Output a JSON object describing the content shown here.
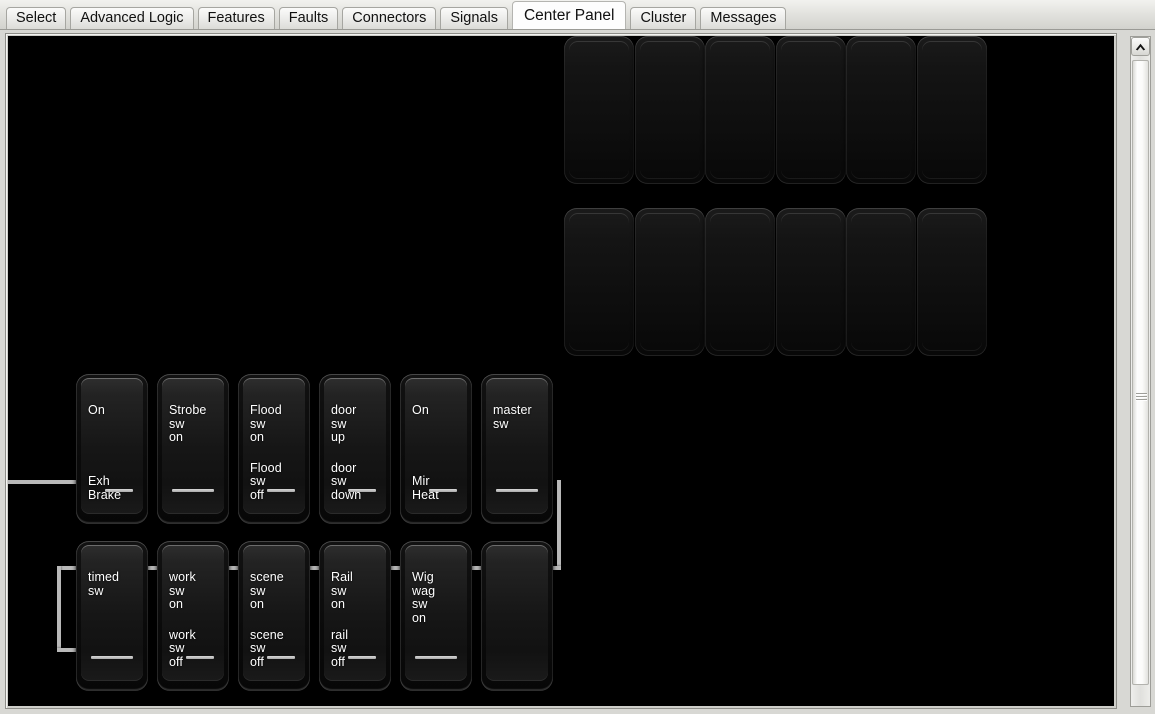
{
  "window": {
    "title": "Center Panel"
  },
  "tabs": [
    {
      "label": "Select",
      "active": false
    },
    {
      "label": "Advanced Logic",
      "active": false
    },
    {
      "label": "Features",
      "active": false
    },
    {
      "label": "Faults",
      "active": false
    },
    {
      "label": "Connectors",
      "active": false
    },
    {
      "label": "Signals",
      "active": false
    },
    {
      "label": "Center Panel",
      "active": true
    },
    {
      "label": "Cluster",
      "active": false
    },
    {
      "label": "Messages",
      "active": false
    }
  ],
  "panel": {
    "background_color": "#000000",
    "frame_color": "#cfcfca",
    "wire_color": "#b9b9b9"
  },
  "empty_slots": {
    "count": 12,
    "rows": 2,
    "columns": 6
  },
  "switch_rows": [
    {
      "row": 1,
      "switches": [
        {
          "top_label": "On",
          "bottom_label": "Exh\nBrake",
          "bar": "short"
        },
        {
          "top_label": "Strobe\nsw\non",
          "bottom_label": "",
          "bar": "full"
        },
        {
          "top_label": "Flood\nsw\non",
          "bottom_label": "Flood\nsw\noff",
          "bar": "short"
        },
        {
          "top_label": "door\nsw\nup",
          "bottom_label": "door\nsw\ndown",
          "bar": "short"
        },
        {
          "top_label": "On",
          "bottom_label": "Mir\nHeat",
          "bar": "short"
        },
        {
          "top_label": "master\nsw",
          "bottom_label": "",
          "bar": "full"
        }
      ]
    },
    {
      "row": 2,
      "switches": [
        {
          "top_label": "timed\nsw",
          "bottom_label": "",
          "bar": "full"
        },
        {
          "top_label": "work\nsw\non",
          "bottom_label": "work\nsw\noff",
          "bar": "short"
        },
        {
          "top_label": "scene\nsw\non",
          "bottom_label": "scene\nsw\noff",
          "bar": "short"
        },
        {
          "top_label": "Rail\nsw\non",
          "bottom_label": "rail\nsw\noff",
          "bar": "short"
        },
        {
          "top_label": "Wig\nwag\nsw\non",
          "bottom_label": "",
          "bar": "full"
        },
        {
          "top_label": "",
          "bottom_label": "",
          "bar": "none"
        }
      ]
    }
  ],
  "scrollbar": {
    "up_arrow_icon": "chevron-up-icon",
    "orientation": "vertical"
  }
}
